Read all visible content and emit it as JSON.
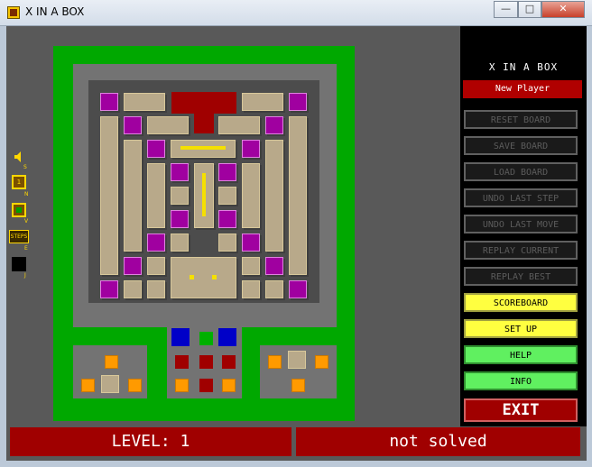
{
  "window": {
    "title": "X IN A BOX",
    "controls": {
      "minimize": "—",
      "maximize": "□",
      "close": "✕"
    }
  },
  "sidebar_icons": [
    {
      "name": "sound-icon",
      "label": "S"
    },
    {
      "name": "level-number-icon",
      "label": "N",
      "value": "1"
    },
    {
      "name": "view-icon",
      "label": "V"
    },
    {
      "name": "steps-icon",
      "label": "E",
      "value": "STEPS"
    },
    {
      "name": "black-square-icon",
      "label": "J"
    }
  ],
  "panel": {
    "title": "X IN A BOX",
    "player": "New Player",
    "buttons": [
      {
        "label": "RESET BOARD",
        "state": "disabled"
      },
      {
        "label": "SAVE BOARD",
        "state": "disabled"
      },
      {
        "label": "LOAD BOARD",
        "state": "disabled"
      },
      {
        "label": "UNDO LAST STEP",
        "state": "disabled"
      },
      {
        "label": "UNDO LAST MOVE",
        "state": "disabled"
      },
      {
        "label": "REPLAY CURRENT",
        "state": "disabled"
      },
      {
        "label": "REPLAY BEST",
        "state": "disabled"
      },
      {
        "label": "SCOREBOARD",
        "state": "yellow"
      },
      {
        "label": "SET UP",
        "state": "yellow"
      },
      {
        "label": "HELP",
        "state": "green"
      },
      {
        "label": "INFO",
        "state": "green"
      }
    ],
    "exit": "EXIT"
  },
  "status": {
    "level": "LEVEL: 1",
    "state": "not solved"
  },
  "colors": {
    "frame": "#00a800",
    "purple": "#a000a0",
    "bar": "#b8a98a",
    "red": "#a00000",
    "yellow": "#f5e000"
  }
}
